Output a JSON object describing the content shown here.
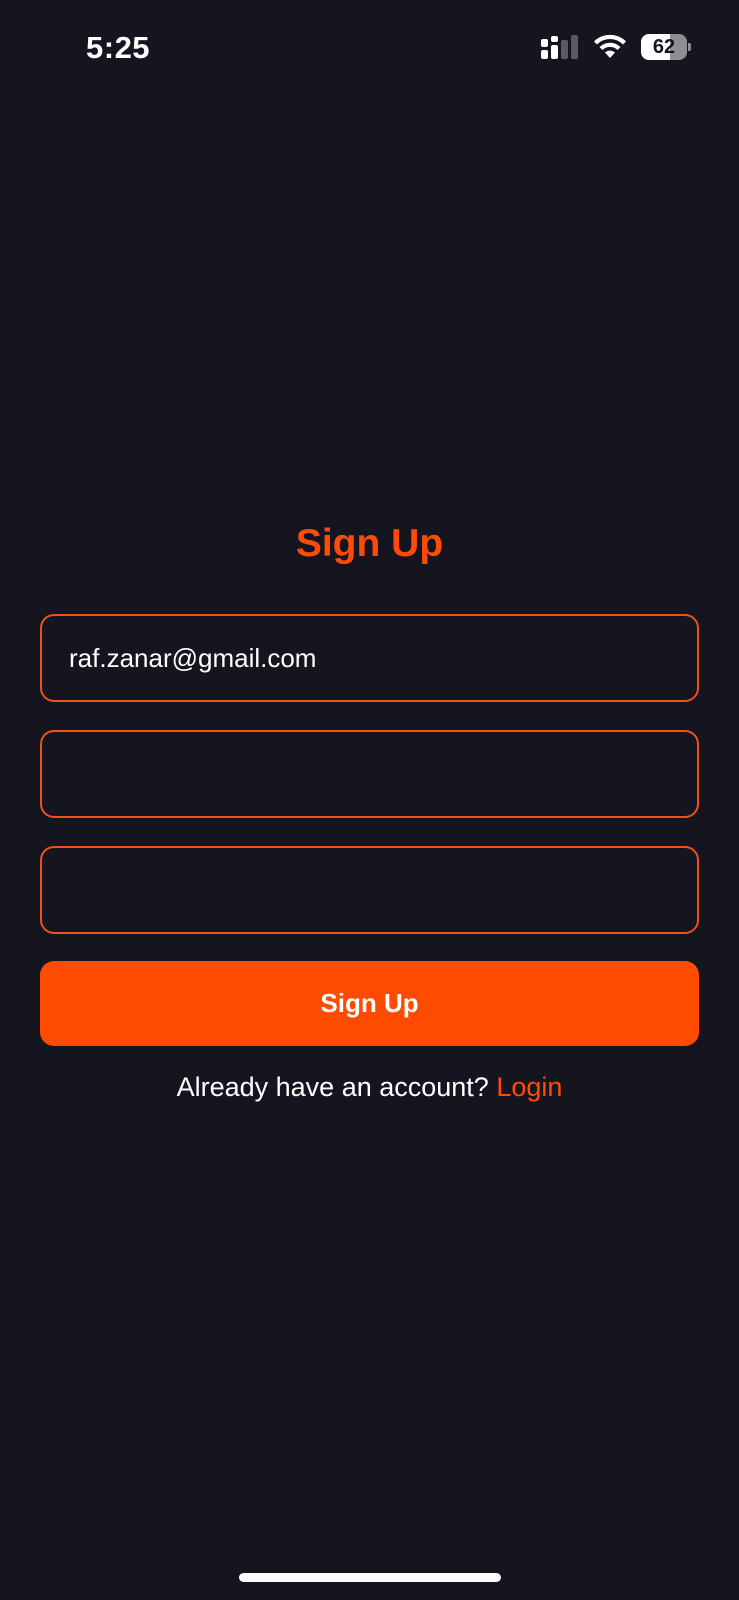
{
  "status_bar": {
    "time": "5:25",
    "battery_level": "62",
    "icons": [
      "signal-icon",
      "wifi-icon",
      "battery-icon"
    ]
  },
  "form": {
    "title": "Sign Up",
    "email_value": "raf.zanar@gmail.com",
    "password_value": "",
    "confirm_password_value": "",
    "submit_label": "Sign Up"
  },
  "footer": {
    "prompt": "Already have an account?",
    "link_label": "Login"
  },
  "colors": {
    "background": "#151520",
    "accent": "#ff4b00",
    "text": "#ffffff"
  }
}
